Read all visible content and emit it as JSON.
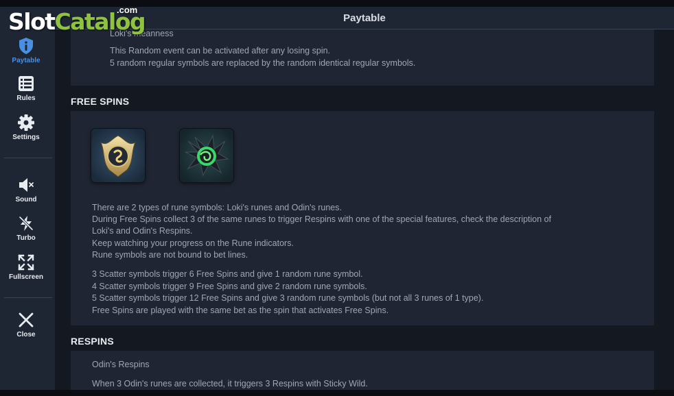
{
  "logo": {
    "brand": "SlotCatalog",
    "part1": "Slot",
    "part2": "Catalog",
    "suffix": ".com"
  },
  "header": {
    "title": "Paytable"
  },
  "sidebar": {
    "items": [
      {
        "label": "Paytable",
        "icon": "info-icon"
      },
      {
        "label": "Rules",
        "icon": "list-icon"
      },
      {
        "label": "Settings",
        "icon": "gear-icon"
      },
      {
        "label": "Sound",
        "icon": "sound-muted-icon"
      },
      {
        "label": "Turbo",
        "icon": "lightning-off-icon"
      },
      {
        "label": "Fullscreen",
        "icon": "fullscreen-icon"
      },
      {
        "label": "Close",
        "icon": "close-icon"
      }
    ],
    "active_color": "#4a90e2"
  },
  "top_panel": {
    "title": "Loki's meanness",
    "lines": [
      "This Random event can be activated after any losing spin.",
      "5 random regular symbols are replaced by the random identical regular symbols."
    ]
  },
  "free_spins": {
    "heading": "FREE SPINS",
    "runes": [
      {
        "name": "Loki's rune",
        "icon": "loki-rune-icon"
      },
      {
        "name": "Odin's rune",
        "icon": "odin-rune-icon"
      }
    ],
    "para1": [
      "There are 2 types of rune symbols: Loki's runes and Odin's runes.",
      "During Free Spins collect 3 of the same runes to trigger Respins with one of the special features, check the description of",
      "Loki's and Odin's Respins.",
      "Keep watching your progress on the Rune indicators.",
      "Rune symbols are not bound to bet lines."
    ],
    "para2": [
      "3 Scatter symbols trigger 6 Free Spins and give 1 random rune symbol.",
      "4 Scatter symbols trigger 9 Free Spins and give 2 random rune symbols.",
      "5 Scatter symbols trigger 12 Free Spins and give 3 random rune symbols (but not all 3 runes of 1 type).",
      "Free Spins are played with the same bet as the spin that activates Free Spins."
    ]
  },
  "respins": {
    "heading": "RESPINS",
    "subtitle": "Odin's Respins",
    "line1": "When 3 Odin's runes are collected, it triggers 3 Respins with Sticky Wild."
  }
}
